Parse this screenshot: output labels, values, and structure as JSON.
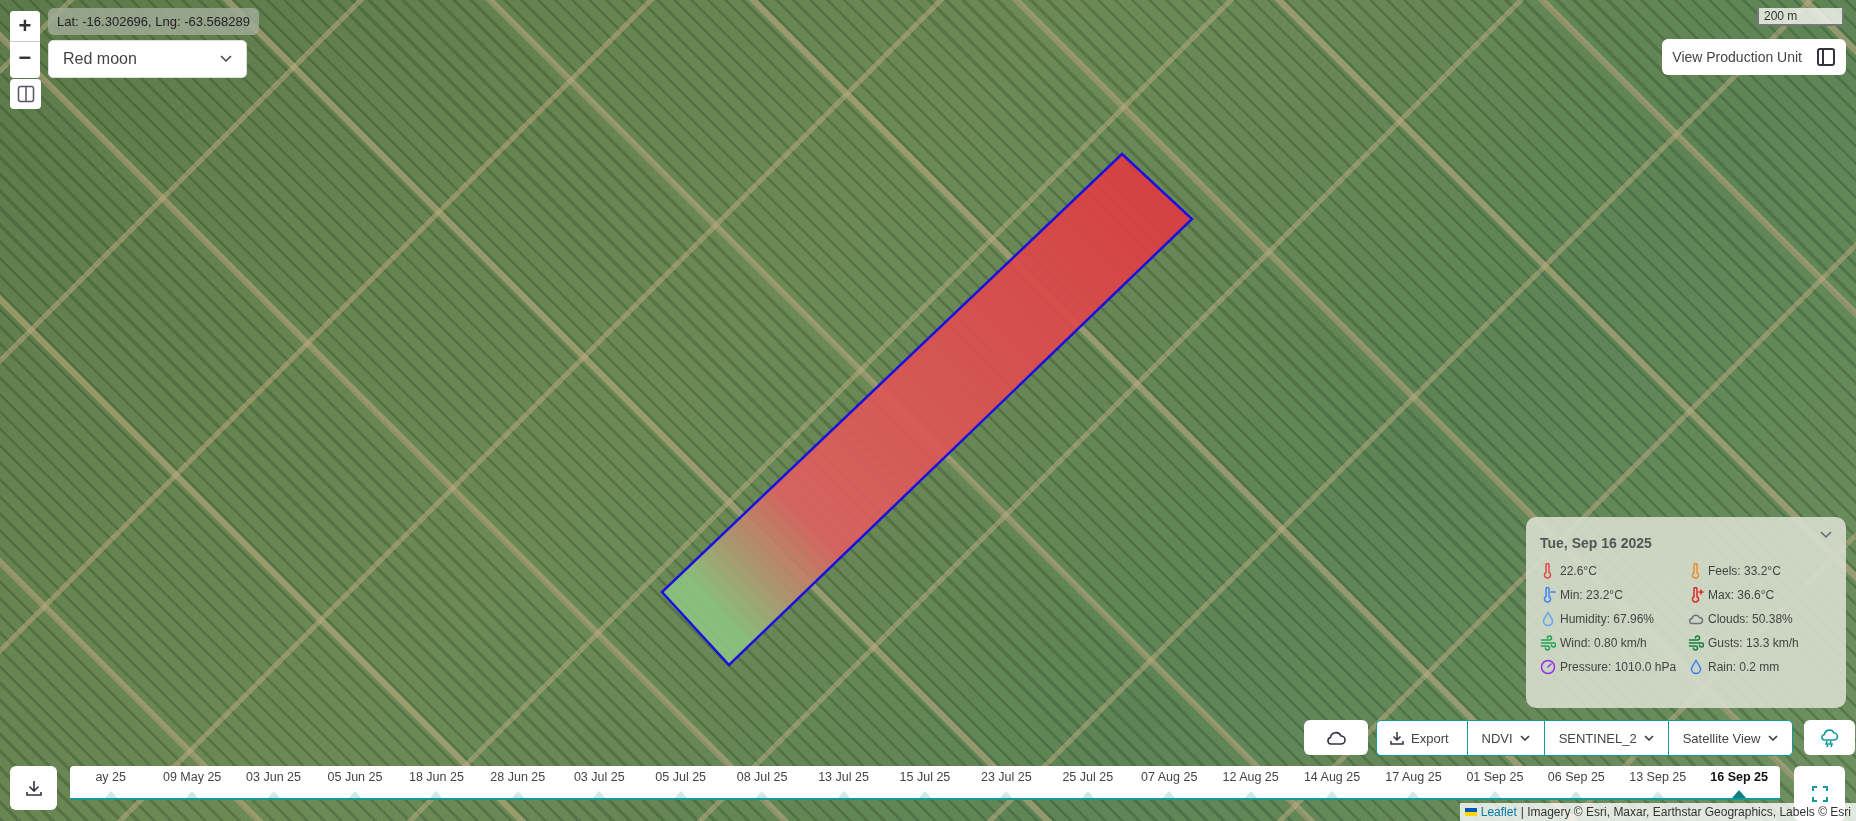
{
  "zoom_controls": {
    "zoom_in": "+",
    "zoom_out": "−"
  },
  "coordinates": "Lat: -16.302696, Lng: -63.568289",
  "farm_select": {
    "value": "Red moon"
  },
  "scale": "200 m",
  "view_production_unit": {
    "label": "View Production Unit"
  },
  "weather": {
    "date": "Tue, Sep 16 2025",
    "expanded": true,
    "items": [
      {
        "kind": "temp",
        "text": "22.6°C"
      },
      {
        "kind": "feels",
        "text": "Feels: 33.2°C"
      },
      {
        "kind": "min",
        "text": "Min: 23.2°C"
      },
      {
        "kind": "max",
        "text": "Max: 36.6°C"
      },
      {
        "kind": "humidity",
        "text": "Humidity: 67.96%"
      },
      {
        "kind": "clouds",
        "text": "Clouds: 50.38%"
      },
      {
        "kind": "wind",
        "text": "Wind: 0.80 km/h"
      },
      {
        "kind": "gusts",
        "text": "Gusts: 13.3 km/h"
      },
      {
        "kind": "pressure",
        "text": "Pressure: 1010.0 hPa"
      },
      {
        "kind": "rain",
        "text": "Rain: 0.2 mm"
      }
    ]
  },
  "toolbar": {
    "export": "Export",
    "index": "NDVI",
    "satellite": "SENTINEL_2",
    "view": "Satellite View"
  },
  "timeline": [
    {
      "label": "ay 25",
      "selected": false
    },
    {
      "label": "09 May 25",
      "selected": false
    },
    {
      "label": "03 Jun 25",
      "selected": false
    },
    {
      "label": "05 Jun 25",
      "selected": false
    },
    {
      "label": "18 Jun 25",
      "selected": false
    },
    {
      "label": "28 Jun 25",
      "selected": false
    },
    {
      "label": "03 Jul 25",
      "selected": false
    },
    {
      "label": "05 Jul 25",
      "selected": false
    },
    {
      "label": "08 Jul 25",
      "selected": false
    },
    {
      "label": "13 Jul 25",
      "selected": false
    },
    {
      "label": "15 Jul 25",
      "selected": false
    },
    {
      "label": "23 Jul 25",
      "selected": false
    },
    {
      "label": "25 Jul 25",
      "selected": false
    },
    {
      "label": "07 Aug 25",
      "selected": false
    },
    {
      "label": "12 Aug 25",
      "selected": false
    },
    {
      "label": "14 Aug 25",
      "selected": false
    },
    {
      "label": "17 Aug 25",
      "selected": false
    },
    {
      "label": "01 Sep 25",
      "selected": false
    },
    {
      "label": "06 Sep 25",
      "selected": false
    },
    {
      "label": "13 Sep 25",
      "selected": false
    },
    {
      "label": "16 Sep 25",
      "selected": true
    }
  ],
  "attribution": {
    "link": "Leaflet",
    "text": "| Imagery © Esri, Maxar, Earthstar Geographics, Labels © Esri"
  }
}
